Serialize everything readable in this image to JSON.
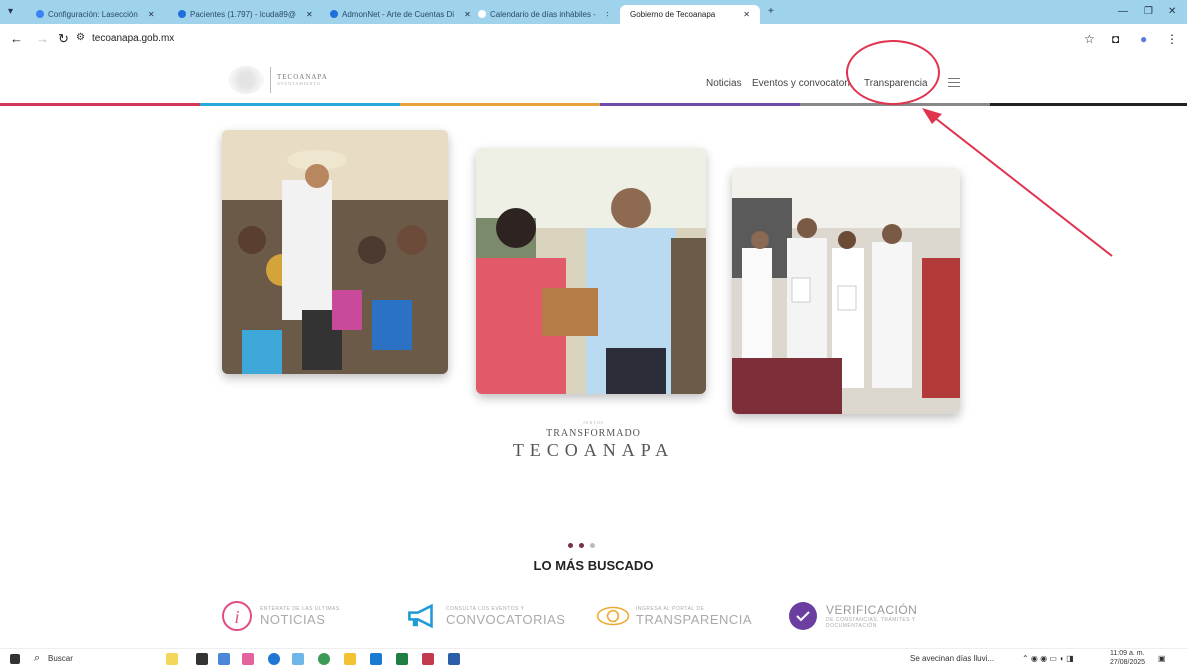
{
  "browser": {
    "tabs": [
      {
        "label": "Configuración: Lasección",
        "color": "#3b82f6"
      },
      {
        "label": "Pacientes (1.797) - lcuda89@",
        "color": "#1e6fd9"
      },
      {
        "label": "AdmonNet - Arte de Cuentas Di",
        "color": "#1e6fd9"
      },
      {
        "label": "Calendario de días inhábiles - ",
        "color": "#ffffff"
      }
    ],
    "active_tab": "Gobierno de Tecoanapa",
    "new_tab": "+",
    "url": "tecoanapa.gob.mx"
  },
  "site": {
    "logo_text": "TECOANAPA",
    "logo_sub": "AYUNTAMIENTO",
    "nav": {
      "noticias": "Noticias",
      "eventos": "Eventos y convocatorias",
      "transparencia": "Transparencia"
    },
    "stripe_colors": [
      "#d2375e",
      "#2aa7d6",
      "#e5a23b",
      "#6f4ca8",
      "#888888",
      "#222222"
    ]
  },
  "hero": {
    "slogan_small": "JUNTOS",
    "slogan_line1": "TRANSFORMADO",
    "slogan_line2": "TECOANAPA"
  },
  "most_searched": {
    "title": "LO MÁS BUSCADO",
    "cards": [
      {
        "small": "ENTÉRATE DE LAS ÚLTIMAS",
        "big": "NOTICIAS",
        "color": "#e04c86",
        "icon": "info-icon"
      },
      {
        "small": "CONSULTA LOS EVENTOS Y",
        "big": "CONVOCATORIAS",
        "color": "#1f9ad6",
        "icon": "megaphone-icon"
      },
      {
        "small": "INGRESA AL PORTAL DE",
        "big": "TRANSPARENCIA",
        "color": "#f0a830",
        "icon": "eye-icon"
      },
      {
        "small": "DE CONSTANCIAS, TRÁMITES Y DOCUMENTACIÓN",
        "big": "VERIFICACIÓN",
        "color": "#6a3fa0",
        "icon": "verified-icon"
      }
    ]
  },
  "taskbar": {
    "search": "Buscar",
    "weather": "Se avecinan días lluvi...",
    "time": "11:09 a. m.",
    "date": "27/08/2025"
  },
  "annotation": {
    "color": "#e0334e"
  }
}
